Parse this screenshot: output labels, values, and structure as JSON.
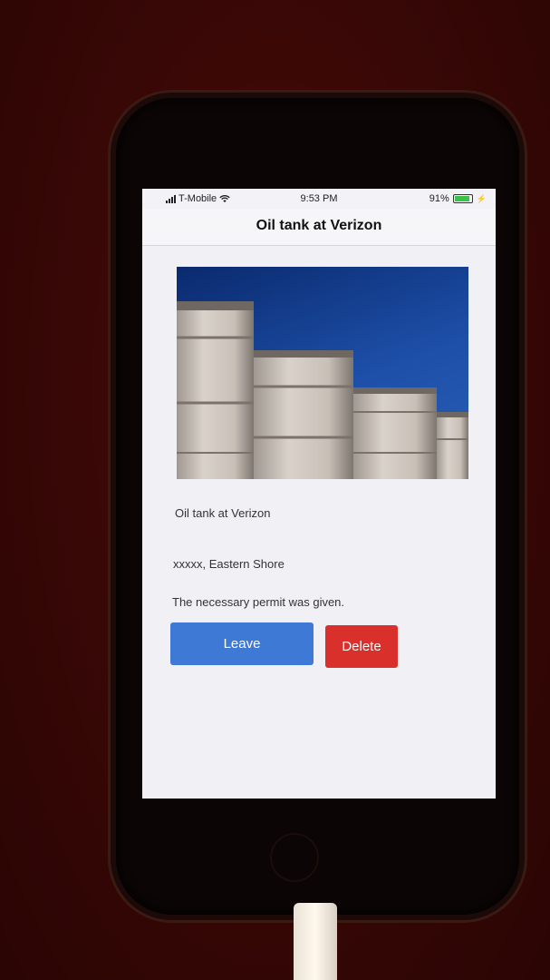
{
  "status_bar": {
    "carrier": "T-Mobile",
    "time": "9:53 PM",
    "battery_percent_text": "91%",
    "battery_level": 0.91,
    "wifi_icon": "wifi-icon",
    "signal_icon": "signal-bars-icon"
  },
  "header": {
    "title": "Oil tank at Verizon"
  },
  "detail": {
    "photo_icon": "oil-tanks-photo",
    "name": "Oil tank at Verizon",
    "location": "xxxxx, Eastern Shore",
    "note": "The necessary permit was given."
  },
  "actions": {
    "leave_label": "Leave",
    "delete_label": "Delete"
  },
  "colors": {
    "leave_button": "#3f79d6",
    "delete_button": "#d9302b",
    "battery": "#3cc24a"
  }
}
